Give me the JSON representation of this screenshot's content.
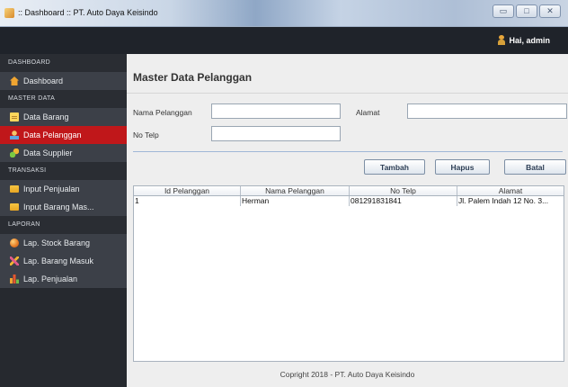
{
  "window": {
    "title": ":: Dashboard :: PT. Auto Daya Keisindo",
    "minimize_glyph": "▭",
    "maximize_glyph": "□",
    "close_glyph": "✕"
  },
  "header": {
    "user_text": "Hai, admin",
    "user_icon": "user-icon"
  },
  "sidebar": {
    "dashboard_header": "DASHBOARD",
    "dashboard": "Dashboard",
    "master_header": "MASTER DATA",
    "data_barang": "Data Barang",
    "data_pelanggan": "Data Pelanggan",
    "data_supplier": "Data Supplier",
    "transaksi_header": "TRANSAKSI",
    "input_penjualan": "Input Penjualan",
    "input_barang_masuk": "Input Barang Mas...",
    "laporan_header": "LAPORAN",
    "lap_stock": "Lap. Stock Barang",
    "lap_masuk": "Lap. Barang Masuk",
    "lap_penjualan": "Lap. Penjualan",
    "active_color": "#c0171a"
  },
  "main": {
    "title": "Master Data Pelanggan",
    "form": {
      "nama_label": "Nama Pelanggan",
      "nama_value": "",
      "alamat_label": "Alamat",
      "alamat_value": "",
      "telp_label": "No Telp",
      "telp_value": ""
    },
    "buttons": {
      "tambah": "Tambah",
      "hapus": "Hapus",
      "batal": "Batal"
    },
    "table": {
      "columns": [
        "Id Pelanggan",
        "Nama Pelanggan",
        "No Telp",
        "Alamat"
      ],
      "rows": [
        [
          "1",
          "Herman",
          "081291831841",
          "Jl. Palem Indah 12 No. 3..."
        ]
      ]
    },
    "footer": "Copright 2018 - PT. Auto Daya Keisindo"
  }
}
